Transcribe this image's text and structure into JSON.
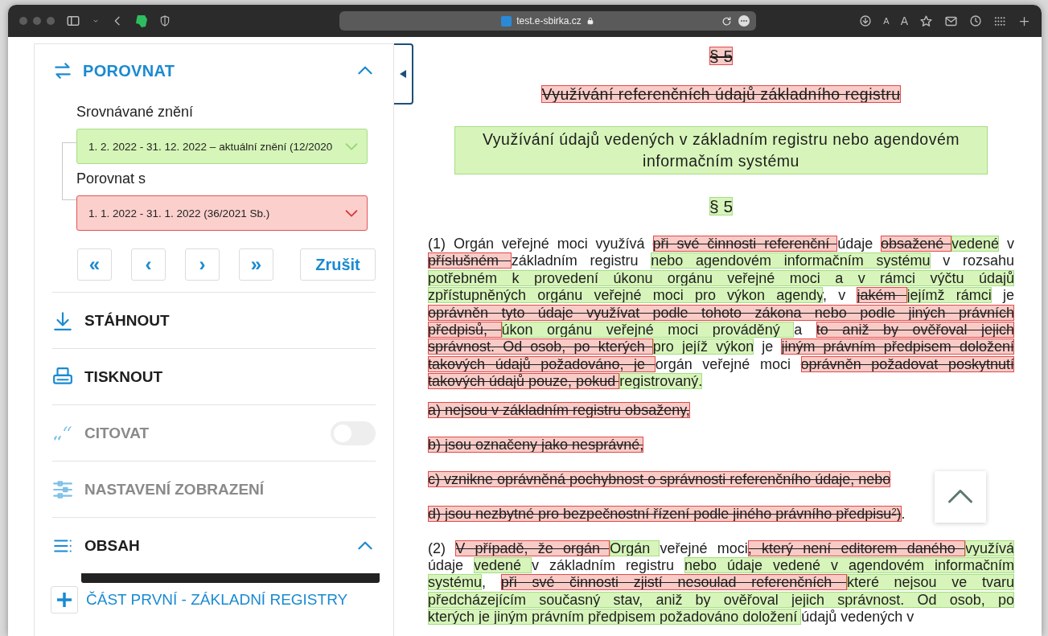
{
  "browser": {
    "url": "test.e-sbirka.cz",
    "font_buttons": [
      "A",
      "A"
    ]
  },
  "panel": {
    "compare": {
      "title": "POROVNAT",
      "expanded": true,
      "fields": [
        {
          "label": "Srovnávané znění",
          "value": "1. 2. 2022 - 31. 12. 2022 – aktuální znění (12/2020",
          "kind": "inserted"
        },
        {
          "label": "Porovnat s",
          "value": "1. 1. 2022 - 31. 1. 2022 (36/2021 Sb.)",
          "kind": "deleted"
        }
      ],
      "nav_buttons": [
        "«",
        "‹",
        "›",
        "»"
      ],
      "cancel": "Zrušit"
    },
    "menu": [
      {
        "kind": "download",
        "label": "STÁHNOUT",
        "disabled": false
      },
      {
        "kind": "print",
        "label": "TISKNOUT",
        "disabled": false
      },
      {
        "kind": "cite",
        "label": "CITOVAT",
        "disabled": true,
        "on": false
      },
      {
        "kind": "settings",
        "label": "NASTAVENÍ ZOBRAZENÍ",
        "disabled": true
      }
    ],
    "contents": {
      "title": "OBSAH",
      "expanded": true,
      "items": [
        {
          "label": "ČÁST PRVNÍ - ZÁKLADNÍ REGISTRY",
          "expanded": false
        }
      ]
    }
  },
  "document": {
    "blocks": [
      {
        "kind": "section",
        "lines": [
          [
            {
              "text": "§ 5",
              "kind": "deleted"
            }
          ]
        ]
      },
      {
        "kind": "heading",
        "lines": [
          [
            {
              "text": "Využívání referenčních údajů základního registru",
              "kind": "deleted"
            }
          ]
        ]
      },
      {
        "kind": "heading",
        "lines": [
          [
            {
              "text": "Využívání údajů vedených v základním registru nebo agendovém informačním systému",
              "kind": "inserted"
            }
          ]
        ]
      },
      {
        "kind": "section",
        "lines": [
          [
            {
              "text": "§ 5",
              "kind": "inserted"
            }
          ]
        ]
      },
      {
        "kind": "paragraph",
        "lines": [
          [
            {
              "text": "(1) Orgán veřejné moci využívá ",
              "kind": "unchanged"
            },
            {
              "text": "při své činnosti referenční ",
              "kind": "deleted"
            },
            {
              "text": "údaje ",
              "kind": "unchanged"
            },
            {
              "text": "obsažené ",
              "kind": "deleted"
            },
            {
              "text": "vedené",
              "kind": "inserted"
            },
            {
              "text": " v",
              "kind": "unchanged"
            }
          ],
          [
            {
              "text": "příslušném ",
              "kind": "deleted"
            },
            {
              "text": "základním registru ",
              "kind": "unchanged"
            },
            {
              "text": "nebo agendovém informačním systému",
              "kind": "inserted"
            },
            {
              "text": " v rozsahu",
              "kind": "unchanged"
            }
          ],
          [
            {
              "text": "potřebném k provedení úkonu orgánu veřejné moci a v rámci výčtu údajů",
              "kind": "inserted"
            }
          ],
          [
            {
              "text": "zpřístupněných orgánu veřejné moci pro výkon agendy",
              "kind": "inserted"
            },
            {
              "text": ", v ",
              "kind": "unchanged"
            },
            {
              "text": "jakém ",
              "kind": "deleted"
            },
            {
              "text": "jejímž rámci",
              "kind": "inserted"
            },
            {
              "text": " je",
              "kind": "unchanged"
            }
          ],
          [
            {
              "text": "oprávněn tyto údaje využívat podle tohoto zákona nebo podle jiných právních",
              "kind": "deleted"
            }
          ],
          [
            {
              "text": "předpisů, ",
              "kind": "deleted"
            },
            {
              "text": "úkon orgánu veřejné moci prováděný ",
              "kind": "inserted"
            },
            {
              "text": " a ",
              "kind": "unchanged"
            },
            {
              "text": "to aniž by ověřoval jejich",
              "kind": "deleted"
            }
          ],
          [
            {
              "text": "správnost. Od osob, po kterých ",
              "kind": "deleted"
            },
            {
              "text": "pro jejíž výkon",
              "kind": "inserted"
            },
            {
              "text": " je ",
              "kind": "unchanged"
            },
            {
              "text": "jiným právním předpisem doložení",
              "kind": "deleted"
            }
          ],
          [
            {
              "text": "takových údajů požadováno, je ",
              "kind": "deleted"
            },
            {
              "text": "orgán veřejné moci ",
              "kind": "unchanged"
            },
            {
              "text": "oprávněn požadovat poskytnutí",
              "kind": "deleted"
            }
          ],
          [
            {
              "text": "takových údajů pouze, pokud ",
              "kind": "deleted"
            },
            {
              "text": "registrovaný.",
              "kind": "inserted"
            }
          ]
        ]
      },
      {
        "kind": "item",
        "lines": [
          [
            {
              "text": "a) nejsou v základním registru obsaženy,",
              "kind": "deleted"
            }
          ]
        ]
      },
      {
        "kind": "item",
        "lines": [
          [
            {
              "text": "b) jsou označeny jako nesprávné,",
              "kind": "deleted"
            }
          ]
        ]
      },
      {
        "kind": "item",
        "lines": [
          [
            {
              "text": "c) vznikne oprávněná pochybnost o správnosti referenčního údaje, nebo",
              "kind": "deleted"
            }
          ]
        ]
      },
      {
        "kind": "item",
        "lines": [
          [
            {
              "text": "d) jsou nezbytné pro bezpečnostní řízení podle jiného právního předpisu$^{2}$)",
              "kind": "deleted"
            },
            {
              "text": ".",
              "kind": "unchanged"
            }
          ]
        ]
      },
      {
        "kind": "paragraph",
        "lines": [
          [
            {
              "text": "(2) ",
              "kind": "unchanged"
            },
            {
              "text": "V případě, že orgán ",
              "kind": "deleted"
            },
            {
              "text": "Orgán ",
              "kind": "inserted"
            },
            {
              "text": " veřejné moci",
              "kind": "unchanged"
            },
            {
              "text": ", který není editorem daného ",
              "kind": "deleted"
            },
            {
              "text": "využívá",
              "kind": "inserted"
            }
          ],
          [
            {
              "text": "údaje ",
              "kind": "unchanged"
            },
            {
              "text": "vedené ",
              "kind": "inserted"
            },
            {
              "text": " v základním registru ",
              "kind": "unchanged"
            },
            {
              "text": "nebo údaje vedené v agendovém informačním",
              "kind": "inserted"
            }
          ],
          [
            {
              "text": "systému",
              "kind": "inserted"
            },
            {
              "text": ", ",
              "kind": "unchanged"
            },
            {
              "text": "při své činnosti zjistí nesoulad referenčních ",
              "kind": "deleted"
            },
            {
              "text": "které nejsou ve tvaru",
              "kind": "inserted"
            }
          ],
          [
            {
              "text": "předcházejícím současný stav, aniž by ověřoval jejich správnost. Od osob, po",
              "kind": "inserted"
            }
          ],
          [
            {
              "text": "kterých je jiným právním předpisem požadováno doložení ",
              "kind": "inserted"
            },
            {
              "text": "údajů vedených v",
              "kind": "unchanged"
            }
          ]
        ]
      }
    ]
  }
}
